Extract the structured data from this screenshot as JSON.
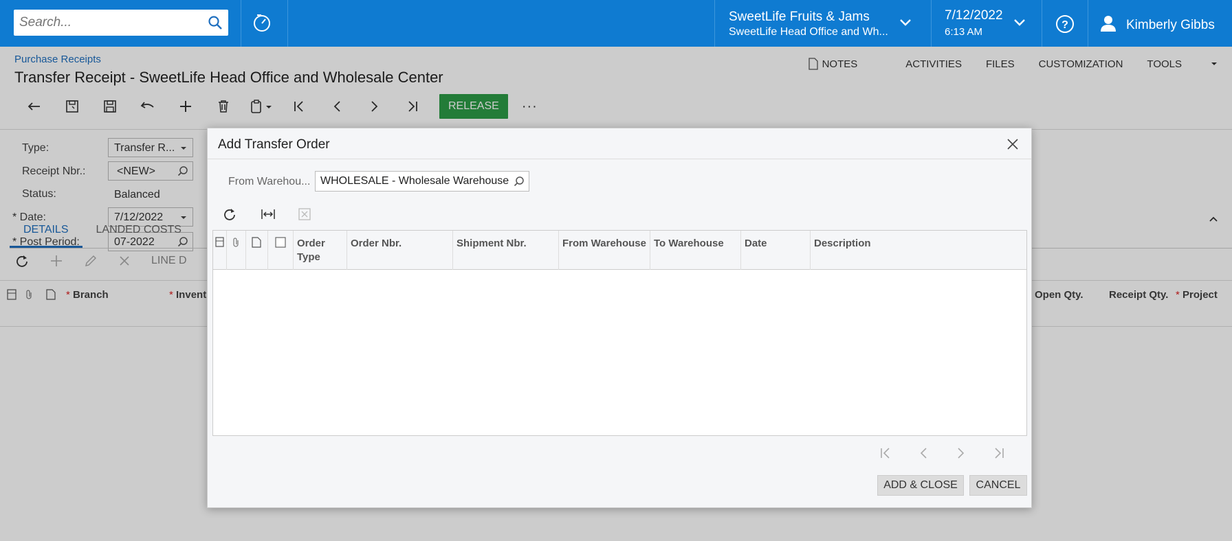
{
  "topbar": {
    "search_placeholder": "Search...",
    "company_name": "SweetLife Fruits & Jams",
    "branch_name": "SweetLife Head Office and Wh...",
    "date": "7/12/2022",
    "time": "6:13 AM",
    "user_name": "Kimberly Gibbs"
  },
  "header": {
    "breadcrumb": "Purchase Receipts",
    "title": "Transfer Receipt - SweetLife Head Office and Wholesale Center",
    "links": [
      "NOTES",
      "ACTIVITIES",
      "FILES",
      "CUSTOMIZATION",
      "TOOLS"
    ]
  },
  "toolbar": {
    "release_label": "RELEASE",
    "more_label": "···"
  },
  "form": {
    "type_label": "Type:",
    "type_value": "Transfer R...",
    "receipt_label": "Receipt Nbr.:",
    "receipt_value": "<NEW>",
    "status_label": "Status:",
    "status_value": "Balanced",
    "date_label": "Date:",
    "date_value": "7/12/2022",
    "period_label": "Post Period:",
    "period_value": "07-2022"
  },
  "tabs": [
    "DETAILS",
    "LANDED COSTS"
  ],
  "grid_toolbar": {
    "line_details": "LINE D"
  },
  "grid_columns": {
    "branch": "Branch",
    "inventory": "Invent",
    "open_qty": "Open Qty.",
    "receipt_qty": "Receipt Qty.",
    "project": "Project"
  },
  "dialog": {
    "title": "Add Transfer Order",
    "from_warehouse_label": "From Warehou...",
    "from_warehouse_value": "WHOLESALE - Wholesale Warehouse",
    "columns": [
      "Order Type",
      "Order Nbr.",
      "Shipment Nbr.",
      "From Warehouse",
      "To Warehouse",
      "Date",
      "Description"
    ],
    "add_close_label": "ADD & CLOSE",
    "cancel_label": "CANCEL"
  }
}
